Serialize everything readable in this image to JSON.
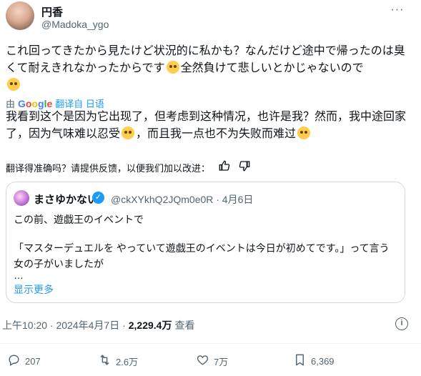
{
  "author": {
    "display_name": "円香",
    "handle": "@Madoka_ygo"
  },
  "tweet": {
    "text_part1": "これ回ってきたから見たけど状況的に私かも？なんだけど途中で帰ったのは臭くて耐えきれなかったからです",
    "text_part2": "全然負けて悲しいとかじゃないので",
    "emoji": "pleading-face-emoji"
  },
  "translation": {
    "by_label": "由",
    "provider": "Google",
    "translated_from": "翻译自 日语",
    "text_part1": "我看到这个是因为它出现了，但考虑到这种情况，也许是我？然而，我中途回家了，因为气味难以忍受",
    "text_part2": "，而且我一点也不为失败而难过",
    "feedback_prompt": "翻译得准确吗？请提供反馈，以便我们加以改进："
  },
  "quote": {
    "name": "まさゆかない",
    "meta": "@ckXYkhQ2JQm0e0R · 4月6日",
    "line1": "この前、遊戯王のイベントで",
    "line2": "「マスターデュエルを やっていて遊戯王のイベントは今日が初めてです。」って言う女の子がいましたが",
    "ellipsis": "…",
    "show_more": "显示更多"
  },
  "meta": {
    "timestamp": "上午10:20 · 2024年4月7日 · ",
    "views_count": "2,229.4万",
    "views_label": "查看"
  },
  "actions": {
    "replies": "207",
    "retweets": "2.6万",
    "likes": "7万",
    "bookmarks": "6,369"
  },
  "icons": {
    "more": "more-icon",
    "reply": "reply-icon",
    "retweet": "retweet-icon",
    "like": "heart-icon",
    "bookmark": "bookmark-icon",
    "thumbs_up": "thumbs-up-icon",
    "thumbs_down": "thumbs-down-icon",
    "verified": "verified-icon",
    "info": "info-icon"
  },
  "colors": {
    "accent": "#1d9bf0",
    "secondary_text": "#536471",
    "border": "#cfd9de"
  }
}
